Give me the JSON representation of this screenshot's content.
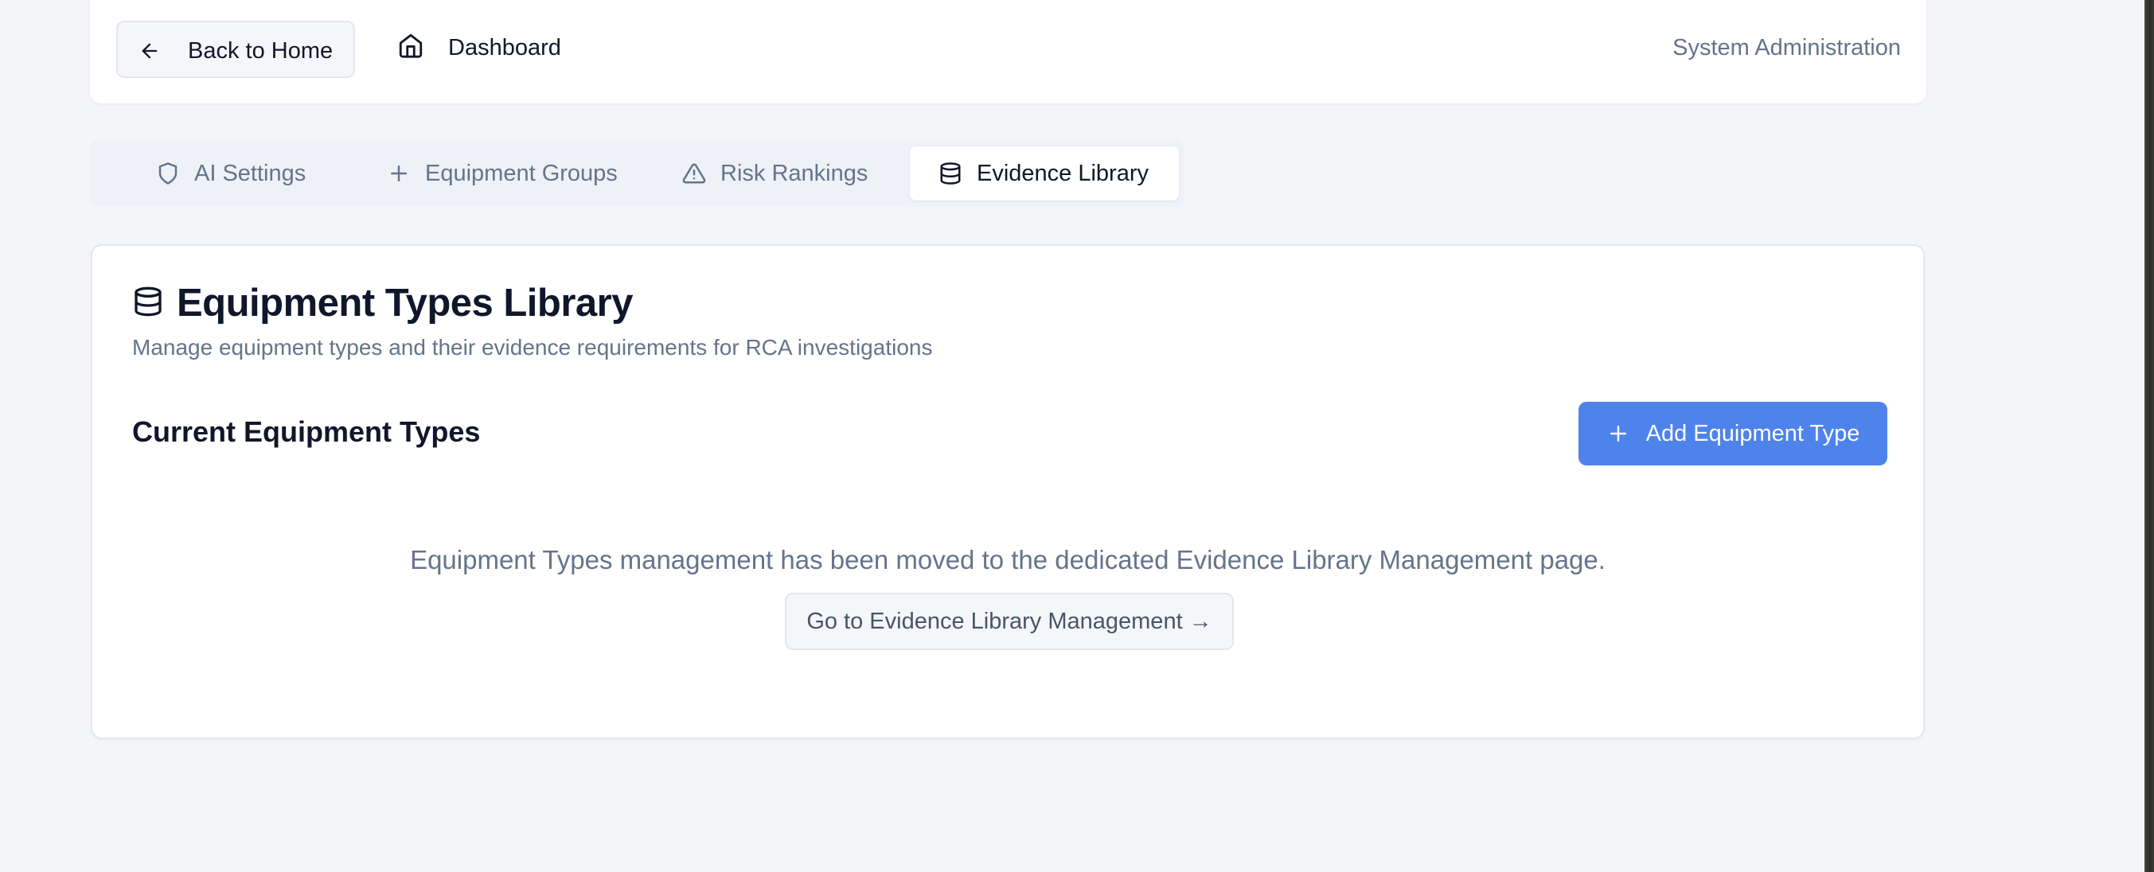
{
  "header": {
    "back_label": "Back to Home",
    "dashboard_label": "Dashboard",
    "section_label": "System Administration"
  },
  "tabs": [
    {
      "label": "AI Settings",
      "icon": "shield-icon",
      "active": false
    },
    {
      "label": "Equipment Groups",
      "icon": "plus-icon",
      "active": false
    },
    {
      "label": "Risk Rankings",
      "icon": "warning-triangle-icon",
      "active": false
    },
    {
      "label": "Evidence Library",
      "icon": "database-icon",
      "active": true
    }
  ],
  "card": {
    "title": "Equipment Types Library",
    "description": "Manage equipment types and their evidence requirements for RCA investigations",
    "section_title": "Current Equipment Types",
    "add_button_label": "Add Equipment Type",
    "moved_message": "Equipment Types management has been moved to the dedicated Evidence Library Management page.",
    "goto_button_label": "Go to Evidence Library Management →"
  },
  "colors": {
    "accent": "#4e83ec",
    "background": "#f4f5f9",
    "muted_text": "#64748b"
  }
}
